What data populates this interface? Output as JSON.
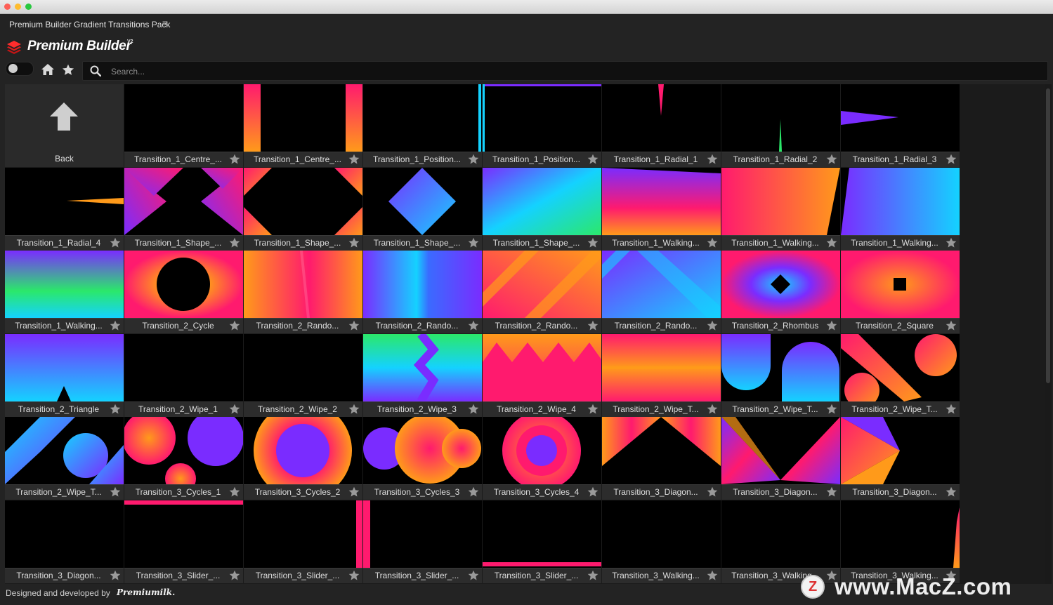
{
  "window": {
    "panel_title": "Premium Builder Gradient Transitions Pack"
  },
  "brand": {
    "name": "Premium Builder",
    "version": "V2"
  },
  "search": {
    "placeholder": "Search..."
  },
  "back": {
    "label": "Back"
  },
  "items": [
    {
      "label": "Transition_1_Centre_..."
    },
    {
      "label": "Transition_1_Centre_..."
    },
    {
      "label": "Transition_1_Position..."
    },
    {
      "label": "Transition_1_Position..."
    },
    {
      "label": "Transition_1_Radial_1"
    },
    {
      "label": "Transition_1_Radial_2"
    },
    {
      "label": "Transition_1_Radial_3"
    },
    {
      "label": "Transition_1_Radial_4"
    },
    {
      "label": "Transition_1_Shape_..."
    },
    {
      "label": "Transition_1_Shape_..."
    },
    {
      "label": "Transition_1_Shape_..."
    },
    {
      "label": "Transition_1_Shape_..."
    },
    {
      "label": "Transition_1_Walking..."
    },
    {
      "label": "Transition_1_Walking..."
    },
    {
      "label": "Transition_1_Walking..."
    },
    {
      "label": "Transition_1_Walking..."
    },
    {
      "label": "Transition_2_Cycle"
    },
    {
      "label": "Transition_2_Rando..."
    },
    {
      "label": "Transition_2_Rando..."
    },
    {
      "label": "Transition_2_Rando..."
    },
    {
      "label": "Transition_2_Rando..."
    },
    {
      "label": "Transition_2_Rhombus"
    },
    {
      "label": "Transition_2_Square"
    },
    {
      "label": "Transition_2_Triangle"
    },
    {
      "label": "Transition_2_Wipe_1"
    },
    {
      "label": "Transition_2_Wipe_2"
    },
    {
      "label": "Transition_2_Wipe_3"
    },
    {
      "label": "Transition_2_Wipe_4"
    },
    {
      "label": "Transition_2_Wipe_T..."
    },
    {
      "label": "Transition_2_Wipe_T..."
    },
    {
      "label": "Transition_2_Wipe_T..."
    },
    {
      "label": "Transition_2_Wipe_T..."
    },
    {
      "label": "Transition_3_Cycles_1"
    },
    {
      "label": "Transition_3_Cycles_2"
    },
    {
      "label": "Transition_3_Cycles_3"
    },
    {
      "label": "Transition_3_Cycles_4"
    },
    {
      "label": "Transition_3_Diagon..."
    },
    {
      "label": "Transition_3_Diagon..."
    },
    {
      "label": "Transition_3_Diagon..."
    },
    {
      "label": "Transition_3_Diagon..."
    },
    {
      "label": "Transition_3_Slider_..."
    },
    {
      "label": "Transition_3_Slider_..."
    },
    {
      "label": "Transition_3_Slider_..."
    },
    {
      "label": "Transition_3_Slider_..."
    },
    {
      "label": "Transition_3_Walking..."
    },
    {
      "label": "Transition_3_Walking..."
    },
    {
      "label": "Transition_3_Walking..."
    }
  ],
  "footer": {
    "text": "Designed and developed by",
    "brand": "Premiumilk."
  },
  "watermark": {
    "text": "www.MacZ.com",
    "badge": "Z"
  },
  "colors": {
    "pink": "#ff1a6e",
    "orange": "#ff9a1a",
    "violet": "#7a2cff",
    "cyan": "#14d2ff",
    "green": "#2be86a"
  }
}
